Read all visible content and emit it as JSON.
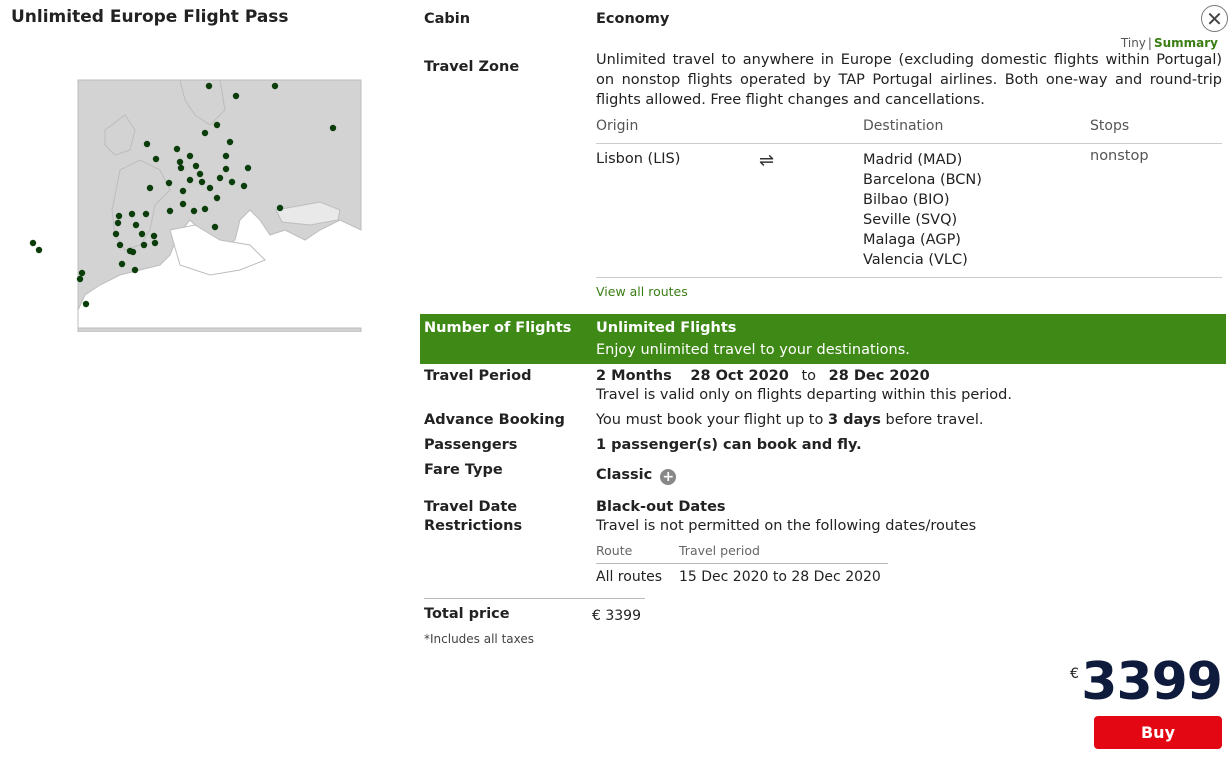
{
  "title": "Unlimited Europe Flight Pass",
  "view_toggle": {
    "tiny": "Tiny",
    "separator": "|",
    "summary": "Summary"
  },
  "close_label": "✕",
  "cabin": {
    "label": "Cabin",
    "value": "Economy"
  },
  "travel_zone": {
    "label": "Travel Zone",
    "description": "Unlimited travel to anywhere in Europe (excluding domestic flights within Portugal) on nonstop flights operated by TAP Portugal airlines. Both one-way and round-trip flights allowed. Free flight changes and cancellations.",
    "columns": {
      "origin": "Origin",
      "destination": "Destination",
      "stops": "Stops"
    },
    "origin": "Lisbon (LIS)",
    "destinations": [
      "Madrid (MAD)",
      "Barcelona (BCN)",
      "Bilbao (BIO)",
      "Seville (SVQ)",
      "Malaga (AGP)",
      "Valencia (VLC)"
    ],
    "stops": "nonstop",
    "view_all": "View all routes"
  },
  "flights": {
    "label": "Number of Flights",
    "title": "Unlimited Flights",
    "subtitle": "Enjoy unlimited travel to your destinations."
  },
  "travel_period": {
    "label": "Travel Period",
    "duration": "2 Months",
    "start": "28 Oct 2020",
    "to": "to",
    "end": "28 Dec 2020",
    "note": "Travel is valid only on flights departing within this period."
  },
  "advance_booking": {
    "label": "Advance Booking",
    "prefix": "You must book your flight up to",
    "days": "3 days",
    "suffix": "before travel."
  },
  "passengers": {
    "label": "Passengers",
    "value": "1 passenger(s) can book and fly."
  },
  "fare_type": {
    "label": "Fare Type",
    "value": "Classic",
    "icon": "plus-circle-icon"
  },
  "restrictions": {
    "label_line1": "Travel Date",
    "label_line2": "Restrictions",
    "title": "Black-out Dates",
    "note": "Travel is not permitted on the following dates/routes",
    "columns": {
      "route": "Route",
      "period": "Travel period"
    },
    "rows": [
      {
        "route": "All routes",
        "period": "15 Dec 2020 to 28 Dec 2020"
      }
    ]
  },
  "total": {
    "label": "Total price",
    "value": "€ 3399",
    "note": "*Includes all taxes"
  },
  "price": {
    "currency": "€",
    "amount": "3399"
  },
  "buy_label": "Buy",
  "colors": {
    "accent_green": "#3f8a17",
    "link_green": "#3a7d13",
    "buy_red": "#e30613",
    "price_navy": "#0f1b3d",
    "map_land": "#d3d3d3",
    "map_sea": "#ffffff",
    "map_dot": "#0b3d0b"
  }
}
